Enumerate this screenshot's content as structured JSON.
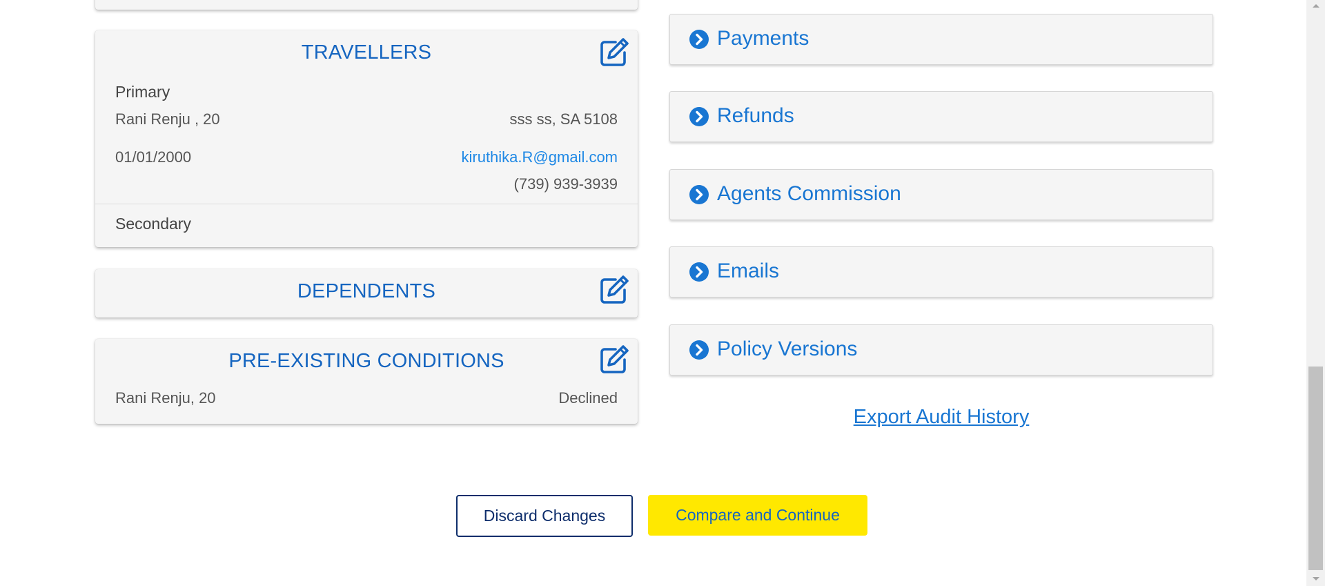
{
  "travellers": {
    "title": "TRAVELLERS",
    "edit_icon": "edit-icon",
    "primary_label": "Primary",
    "primary_name_age": "Rani Renju , 20",
    "primary_address": "sss ss, SA 5108",
    "primary_dob": "01/01/2000",
    "primary_email": "kiruthika.R@gmail.com",
    "primary_phone": "(739) 939-3939",
    "secondary_label": "Secondary"
  },
  "dependents": {
    "title": "DEPENDENTS",
    "edit_icon": "edit-icon"
  },
  "preexisting": {
    "title": "PRE-EXISTING CONDITIONS",
    "edit_icon": "edit-icon",
    "person": "Rani Renju, 20",
    "status": "Declined"
  },
  "accordions": [
    {
      "label": "Payments",
      "icon": "chevron-right-circle-icon"
    },
    {
      "label": "Refunds",
      "icon": "chevron-right-circle-icon"
    },
    {
      "label": "Agents Commission",
      "icon": "chevron-right-circle-icon"
    },
    {
      "label": "Emails",
      "icon": "chevron-right-circle-icon"
    },
    {
      "label": "Policy Versions",
      "icon": "chevron-right-circle-icon"
    }
  ],
  "export_link": "Export Audit History",
  "actions": {
    "discard_label": "Discard Changes",
    "continue_label": "Compare and Continue"
  },
  "colors": {
    "accent_blue": "#1976d2",
    "title_blue": "#1565c0",
    "continue_yellow": "#ffe800",
    "discard_border": "#0d2d6b",
    "card_bg": "#f5f5f5"
  }
}
